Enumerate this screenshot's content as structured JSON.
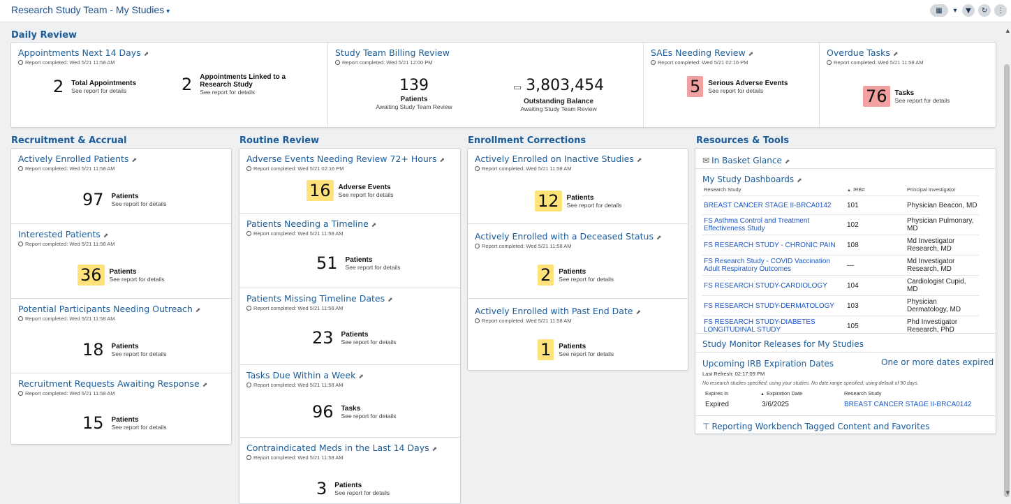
{
  "header": {
    "title": "Research Study Team - My Studies",
    "caret": "▾"
  },
  "sections": {
    "daily_review": "Daily Review",
    "recruitment": "Recruitment & Accrual",
    "routine": "Routine Review",
    "enrollment": "Enrollment Corrections",
    "resources": "Resources & Tools"
  },
  "daily": {
    "appointments": {
      "title": "Appointments Next 14 Days",
      "completed": "Report completed: Wed 5/21 11:58 AM",
      "m1": {
        "value": "2",
        "label": "Total Appointments",
        "sub": "See report for details"
      },
      "m2": {
        "value": "2",
        "label1": "Appointments Linked to a",
        "label2": "Research Study",
        "sub": "See report for details"
      }
    },
    "billing": {
      "title": "Study Team Billing Review",
      "completed": "Report completed: Wed 5/21 12:00 PM",
      "m1": {
        "value": "139",
        "label": "Patients",
        "sub": "Awaiting Study Team Review"
      },
      "m2": {
        "value": "3,803,454",
        "label": "Outstanding Balance",
        "sub": "Awaiting Study Team Review"
      }
    },
    "saes": {
      "title": "SAEs Needing Review",
      "completed": "Report completed: Wed 5/21 02:16 PM",
      "value": "5",
      "label": "Serious Adverse Events",
      "sub": "See report for details"
    },
    "overdue": {
      "title": "Overdue Tasks",
      "completed": "Report completed: Wed 5/21 11:58 AM",
      "value": "76",
      "label": "Tasks",
      "sub": "See report for details"
    }
  },
  "recruitment": [
    {
      "title": "Actively Enrolled Patients",
      "completed": "Report completed: Wed 5/21 11:58 AM",
      "value": "97",
      "label": "Patients",
      "sub": "See report for details"
    },
    {
      "title": "Interested Patients",
      "completed": "Report completed: Wed 5/21 11:58 AM",
      "value": "36",
      "label": "Patients",
      "sub": "See report for details"
    },
    {
      "title": "Potential Participants Needing Outreach",
      "completed": "Report completed: Wed 5/21 11:58 AM",
      "value": "18",
      "label": "Patients",
      "sub": "See report for details"
    },
    {
      "title": "Recruitment Requests Awaiting Response",
      "completed": "Report completed: Wed 5/21 11:58 AM",
      "value": "15",
      "label": "Patients",
      "sub": "See report for details"
    }
  ],
  "routine": [
    {
      "title": "Adverse Events Needing Review 72+ Hours",
      "completed": "Report completed: Wed 5/21 02:16 PM",
      "value": "16",
      "label": "Adverse Events",
      "sub": "See report for details"
    },
    {
      "title": "Patients Needing a Timeline",
      "completed": "Report completed: Wed 5/21 11:58 AM",
      "value": "51",
      "label": "Patients",
      "sub": "See report for details"
    },
    {
      "title": "Patients Missing Timeline Dates",
      "completed": "Report completed: Wed 5/21 11:58 AM",
      "value": "23",
      "label": "Patients",
      "sub": "See report for details"
    },
    {
      "title": "Tasks Due Within a Week",
      "completed": "Report completed: Wed 5/21 11:58 AM",
      "value": "96",
      "label": "Tasks",
      "sub": "See report for details"
    },
    {
      "title": "Contraindicated Meds in the Last 14 Days",
      "completed": "Report completed: Wed 5/21 11:58 AM",
      "value": "3",
      "label": "Patients",
      "sub": "See report for details"
    }
  ],
  "enrollment": [
    {
      "title": "Actively Enrolled on Inactive Studies",
      "completed": "Report completed: Wed 5/21 11:58 AM",
      "value": "12",
      "label": "Patients",
      "sub": "See report for details"
    },
    {
      "title": "Actively Enrolled with a Deceased Status",
      "completed": "Report completed: Wed 5/21 11:58 AM",
      "value": "2",
      "label": "Patients",
      "sub": "See report for details"
    },
    {
      "title": "Actively Enrolled with Past End Date",
      "completed": "Report completed: Wed 5/21 11:58 AM",
      "value": "1",
      "label": "Patients",
      "sub": "See report for details"
    }
  ],
  "resources": {
    "inbasket": "In Basket Glance",
    "dashboards": {
      "title": "My Study Dashboards",
      "columns": [
        "Research Study",
        "IRB#",
        "Principal Investigator"
      ],
      "rows": [
        {
          "study": "BREAST CANCER STAGE II-BRCA0142",
          "irb": "101",
          "pi": "Physician Beacon, MD"
        },
        {
          "study": "FS Asthma Control and Treatment Effectiveness Study",
          "irb": "102",
          "pi": "Physician Pulmonary, MD"
        },
        {
          "study": "FS RESEARCH STUDY - CHRONIC PAIN",
          "irb": "108",
          "pi": "Md Investigator Research, MD"
        },
        {
          "study": "FS Research Study - COVID Vaccination Adult Respiratory Outcomes",
          "irb": "—",
          "pi": "Md Investigator Research, MD"
        },
        {
          "study": "FS RESEARCH STUDY-CARDIOLOGY",
          "irb": "104",
          "pi": "Cardiologist Cupid, MD"
        },
        {
          "study": "FS RESEARCH STUDY-DERMATOLOGY",
          "irb": "103",
          "pi": "Physician Dermatology, MD"
        },
        {
          "study": "FS RESEARCH STUDY-DIABETES LONGITUDINAL STUDY",
          "irb": "105",
          "pi": "Phd Investigator Research, PhD"
        }
      ]
    },
    "monitor": "Study Monitor Releases for My Studies",
    "irb": {
      "title": "Upcoming IRB Expiration Dates",
      "alert": "One or more dates expired",
      "refresh": "Last Refresh: 02:17:09 PM",
      "note": "No research studies specified; using your studies. No date range specified; using default of 90 days.",
      "columns": [
        "Expires In",
        "Expiration Date",
        "Research Study"
      ],
      "row": {
        "expires_in": "Expired",
        "date": "3/6/2025",
        "study": "BREAST CANCER STAGE II-BRCA0142"
      }
    },
    "workbench": "Reporting Workbench Tagged Content and Favorites"
  },
  "colors": {
    "link": "#1b5c98",
    "yellow": "#ffe27a",
    "red": "#f2a0a0"
  },
  "icons": [
    "layout-icon",
    "filter-icon",
    "refresh-icon",
    "more-icon",
    "popout-icon",
    "clock-icon",
    "money-icon",
    "mail-icon",
    "tag-icon"
  ]
}
